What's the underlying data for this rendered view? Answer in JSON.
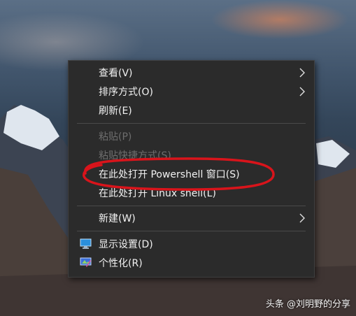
{
  "menu": {
    "items": [
      {
        "label": "查看(V)",
        "has_submenu": true,
        "disabled": false
      },
      {
        "label": "排序方式(O)",
        "has_submenu": true,
        "disabled": false
      },
      {
        "label": "刷新(E)",
        "has_submenu": false,
        "disabled": false
      },
      {
        "label": "粘贴(P)",
        "has_submenu": false,
        "disabled": true
      },
      {
        "label": "粘贴快捷方式(S)",
        "has_submenu": false,
        "disabled": true
      },
      {
        "label": "在此处打开 Powershell 窗口(S)",
        "has_submenu": false,
        "disabled": false
      },
      {
        "label": "在此处打开 Linux shell(L)",
        "has_submenu": false,
        "disabled": false
      },
      {
        "label": "新建(W)",
        "has_submenu": true,
        "disabled": false
      },
      {
        "label": "显示设置(D)",
        "has_submenu": false,
        "disabled": false,
        "icon": "display-settings-icon"
      },
      {
        "label": "个性化(R)",
        "has_submenu": false,
        "disabled": false,
        "icon": "personalize-icon"
      }
    ]
  },
  "annotation": {
    "color": "#d9141b"
  },
  "watermark": {
    "text": "头条 @刘明野的分享"
  }
}
